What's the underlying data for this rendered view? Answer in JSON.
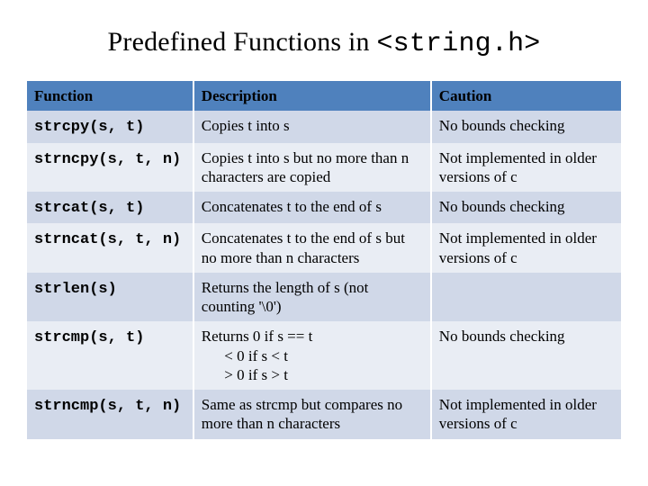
{
  "title_pre": "Predefined Functions in ",
  "title_mono": "<string.h>",
  "headers": {
    "c1": "Function",
    "c2": "Description",
    "c3": "Caution"
  },
  "rows": [
    {
      "fn": "strcpy(s, t)",
      "desc": "Copies t into s",
      "caut": "No bounds checking"
    },
    {
      "fn": "strncpy(s, t, n)",
      "desc": "Copies t into s  but no more than n characters are copied",
      "caut": "Not implemented in older versions of c"
    },
    {
      "fn": "strcat(s, t)",
      "desc": "Concatenates t to the end of s",
      "caut": "No bounds checking"
    },
    {
      "fn": "strncat(s, t, n)",
      "desc": "Concatenates t to the end of s but no more than n characters",
      "caut": "Not implemented in older versions of c"
    },
    {
      "fn": "strlen(s)",
      "desc": "Returns the length of s (not counting '\\0')",
      "caut": ""
    },
    {
      "fn": "strcmp(s, t)",
      "desc_lead": "Returns 0 if s == t",
      "desc_l2": "< 0 if s < t",
      "desc_l3": "> 0 if s > t",
      "caut": "No bounds checking"
    },
    {
      "fn": "strncmp(s, t, n)",
      "desc": "Same as strcmp but compares no more than n characters",
      "caut": "Not implemented in older versions of c"
    }
  ]
}
